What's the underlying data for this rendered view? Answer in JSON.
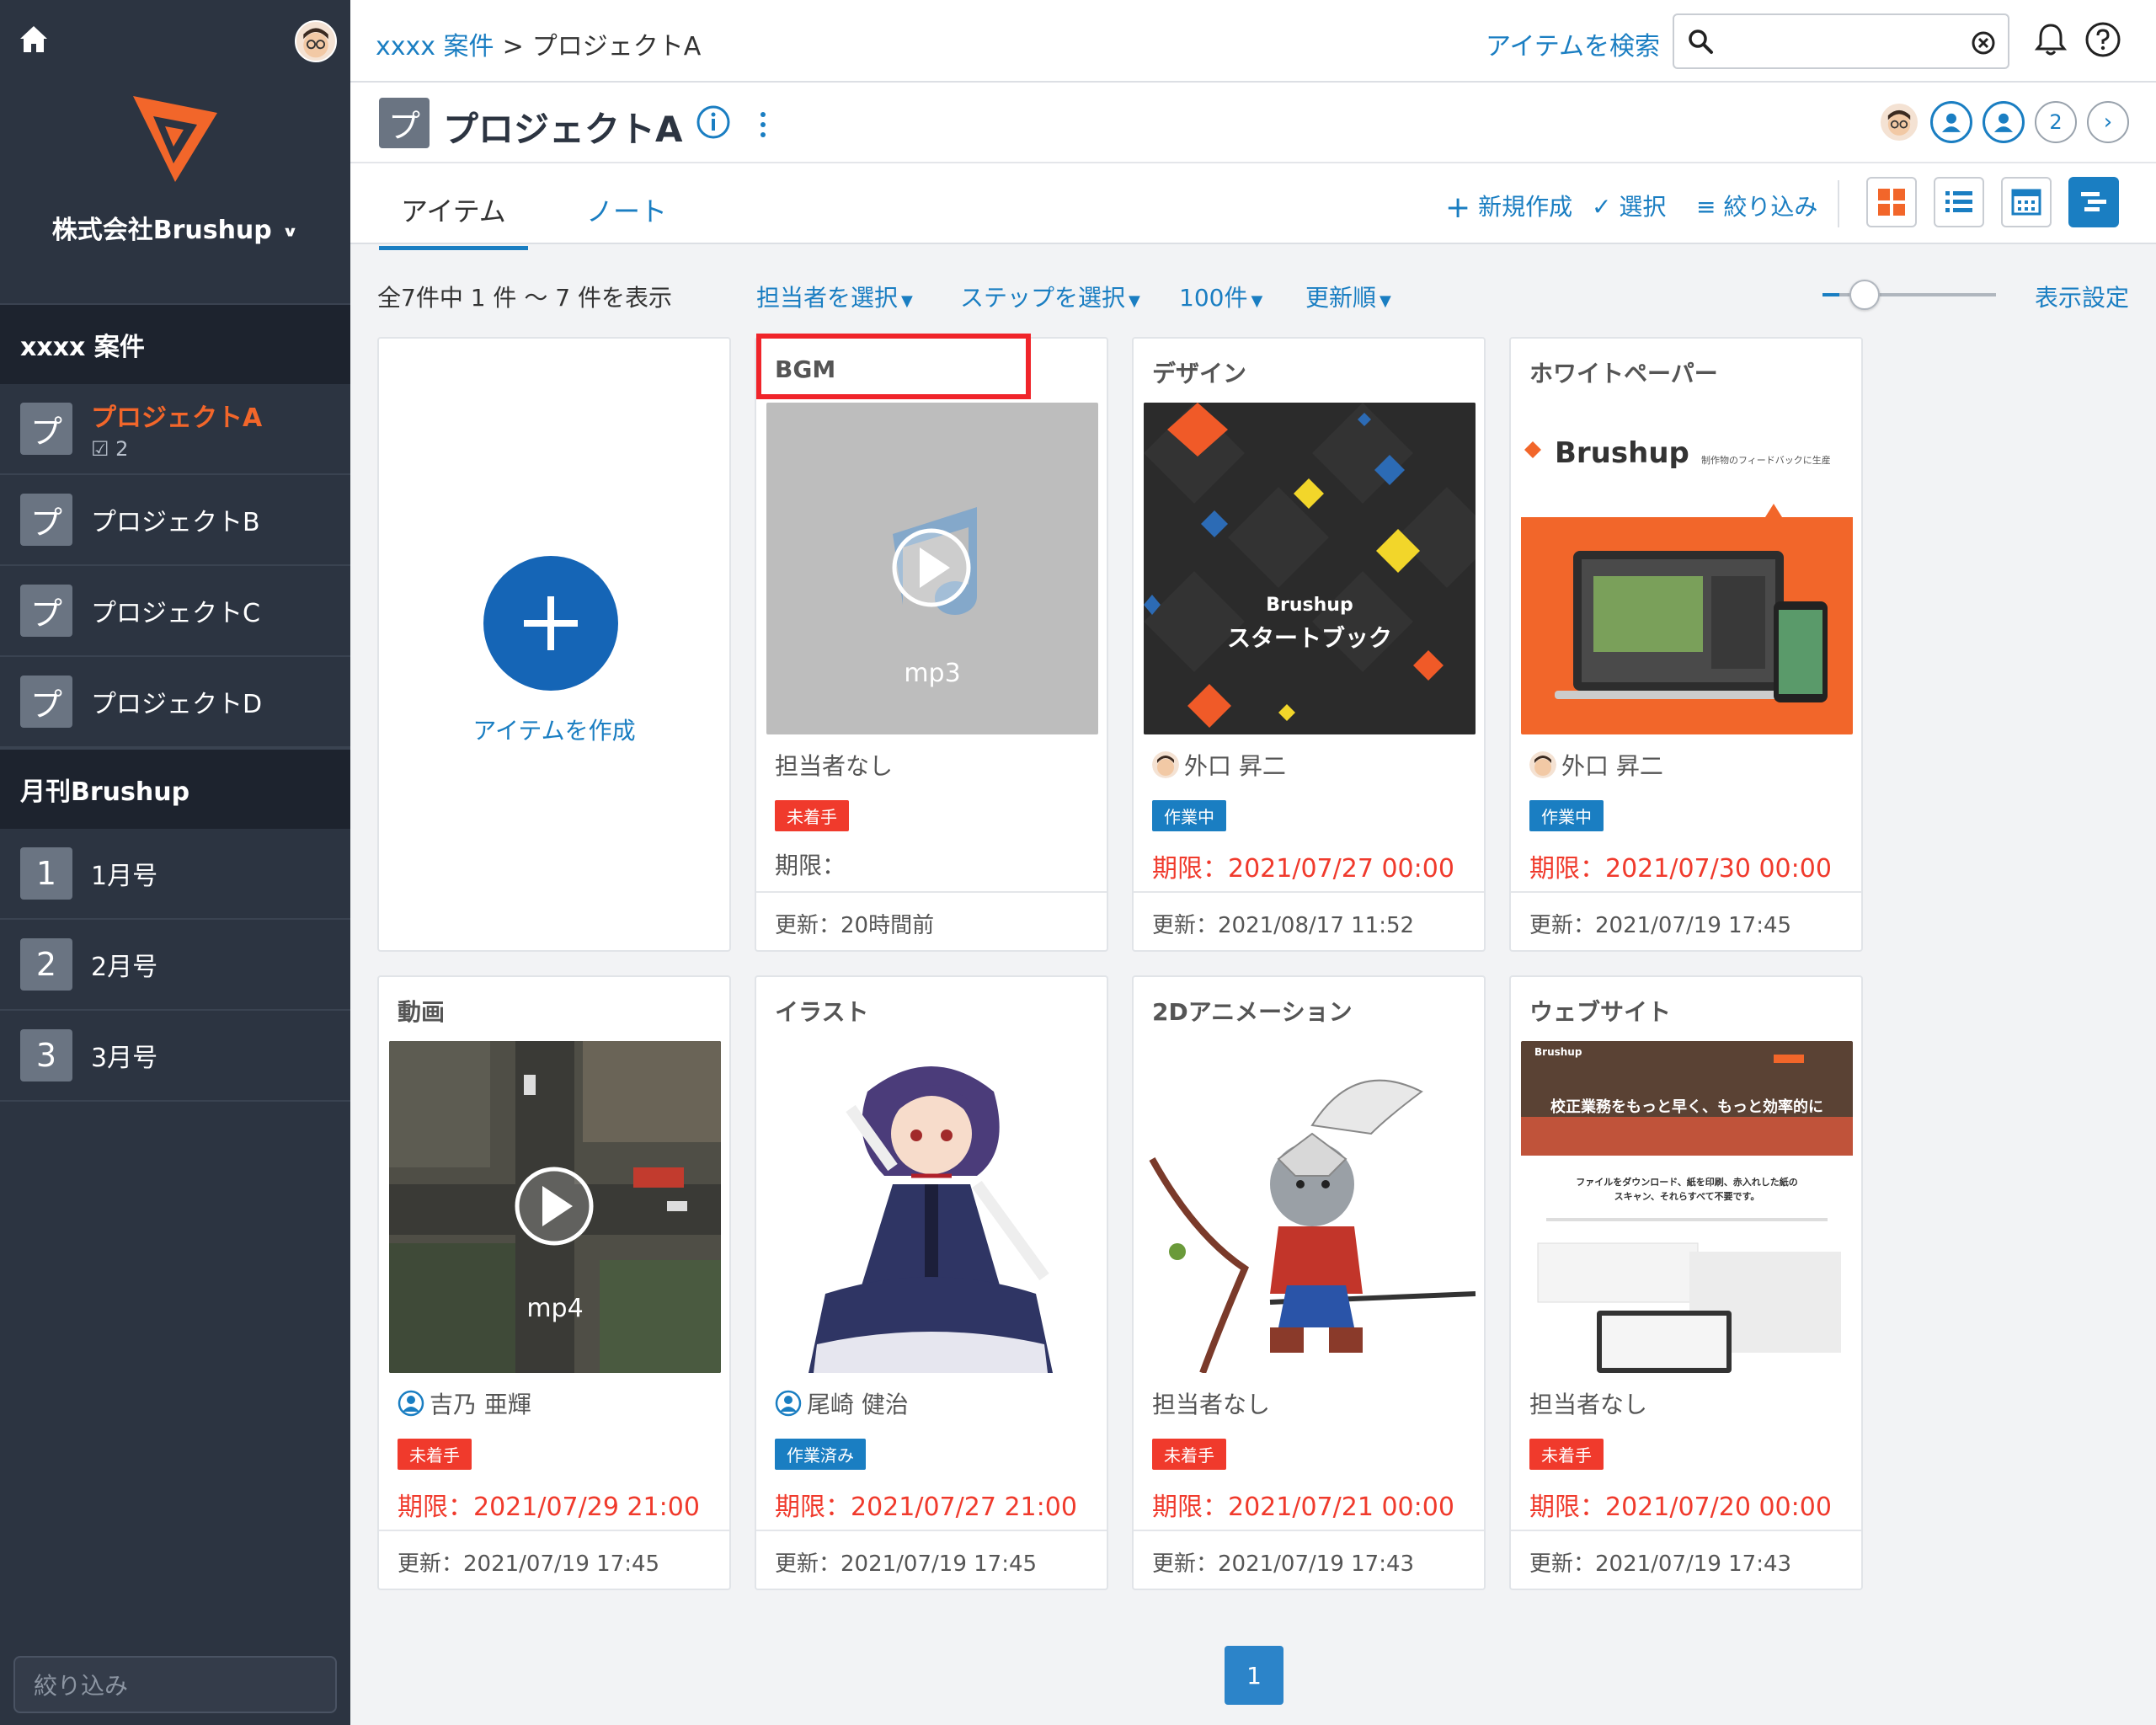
{
  "sidebar": {
    "company": "株式会社Brushup",
    "sections": [
      {
        "label": "xxxx 案件"
      },
      {
        "label": "月刊Brushup"
      }
    ],
    "projects": [
      {
        "badge": "プ",
        "label": "プロジェクトA",
        "sub": "2"
      },
      {
        "badge": "プ",
        "label": "プロジェクトB"
      },
      {
        "badge": "プ",
        "label": "プロジェクトC"
      },
      {
        "badge": "プ",
        "label": "プロジェクトD"
      }
    ],
    "issues": [
      {
        "badge": "1",
        "label": "1月号"
      },
      {
        "badge": "2",
        "label": "2月号"
      },
      {
        "badge": "3",
        "label": "3月号"
      }
    ],
    "filter_placeholder": "絞り込み"
  },
  "topbar": {
    "breadcrumb_parent": "xxxx 案件",
    "breadcrumb_sep": ">",
    "breadcrumb_current": "プロジェクトA",
    "search_link": "アイテムを検索"
  },
  "project": {
    "badge": "プ",
    "title": "プロジェクトA",
    "member_overflow": "2"
  },
  "tabs": {
    "items": "アイテム",
    "notes": "ノート"
  },
  "toolbar": {
    "new": "新規作成",
    "select": "選択",
    "filter": "絞り込み"
  },
  "filters": {
    "count_text": "全7件中 1 件 〜 7 件を表示",
    "assignee": "担当者を選択",
    "step": "ステップを選択",
    "per_page": "100件",
    "sort": "更新順",
    "display_settings": "表示設定"
  },
  "create_item": {
    "label": "アイテムを作成"
  },
  "cards": [
    {
      "title": "BGM",
      "thumb_label": "mp3",
      "assignee": "担当者なし",
      "status": "未着手",
      "deadline": "期限：",
      "updated": "更新：20時間前"
    },
    {
      "title": "デザイン",
      "thumb_brand": "Brushup",
      "thumb_label": "スタートブック",
      "assignee": "外口 昇二",
      "status": "作業中",
      "deadline": "期限：2021/07/27 00:00",
      "updated": "更新：2021/08/17 11:52"
    },
    {
      "title": "ホワイトペーパー",
      "thumb_brand": "Brushup",
      "thumb_tagline": "制作物のフィードバックに生産",
      "assignee": "外口 昇二",
      "status": "作業中",
      "deadline": "期限：2021/07/30 00:00",
      "updated": "更新：2021/07/19 17:45"
    },
    {
      "title": "動画",
      "thumb_label": "mp4",
      "assignee": "吉乃 亜輝",
      "status": "未着手",
      "deadline": "期限：2021/07/29 21:00",
      "updated": "更新：2021/07/19 17:45"
    },
    {
      "title": "イラスト",
      "assignee": "尾崎 健治",
      "status": "作業済み",
      "deadline": "期限：2021/07/27 21:00",
      "updated": "更新：2021/07/19 17:45"
    },
    {
      "title": "2Dアニメーション",
      "assignee": "担当者なし",
      "status": "未着手",
      "deadline": "期限：2021/07/21 00:00",
      "updated": "更新：2021/07/19 17:43"
    },
    {
      "title": "ウェブサイト",
      "thumb_brand": "Brushup",
      "thumb_headline": "校正業務をもっと早く、もっと効率的に",
      "thumb_body": "ファイルをダウンロード、紙を印刷、赤入れした紙のスキャン、それらすべて不要です。",
      "assignee": "担当者なし",
      "status": "未着手",
      "deadline": "期限：2021/07/20 00:00",
      "updated": "更新：2021/07/19 17:43"
    }
  ],
  "pagination": {
    "current": "1"
  },
  "colors": {
    "accent": "#1a7ec2",
    "brand_orange": "#f2662a",
    "danger": "#f03a2c",
    "sidebar_bg": "#2c3441"
  }
}
